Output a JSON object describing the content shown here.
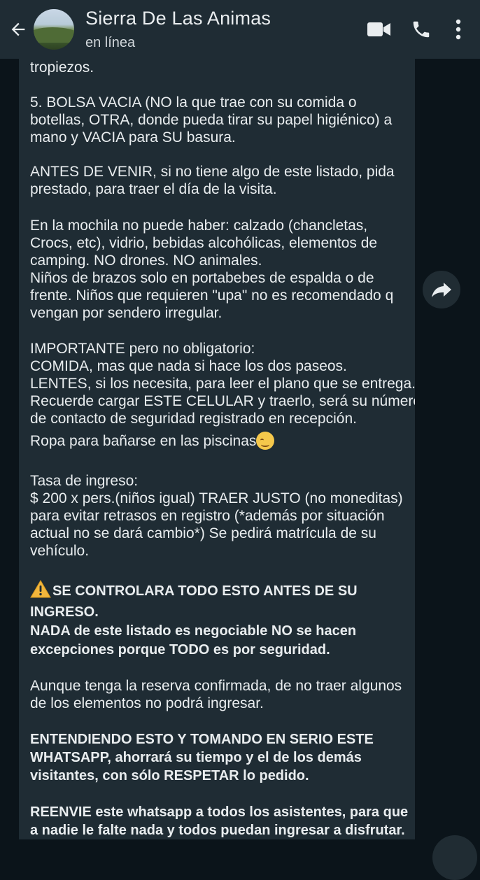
{
  "header": {
    "contact_name": "Sierra De Las Animas",
    "status": "en línea",
    "icons": [
      "back-arrow-icon",
      "video-call-icon",
      "phone-icon",
      "more-options-icon"
    ]
  },
  "message": {
    "lines": [
      "tropiezos.",
      "5. BOLSA VACIA (NO la que trae con su comida o",
      "botellas, OTRA, donde pueda tirar su papel higiénico) a",
      "mano y VACIA para SU basura.",
      "ANTES DE VENIR, si no tiene algo de este listado, pida",
      "prestado, para traer el día de la visita.",
      "En la mochila no puede haber: calzado (chancletas,",
      "Crocs, etc), vidrio, bebidas alcohólicas, elementos de",
      "camping. NO drones. NO animales.",
      "Niños de brazos solo en portabebes de espalda o de",
      "frente. Niños que requieren \"upa\" no es recomendado q",
      "vengan por sendero irregular.",
      "IMPORTANTE pero no obligatorio:",
      "COMIDA, mas que nada si hace los dos paseos.",
      "LENTES, si los necesita, para leer el plano que se entrega.",
      "Recuerde cargar ESTE CELULAR y traerlo, será su número",
      "de contacto de seguridad registrado en recepción.",
      "Ropa para bañarse en las piscinas",
      "Tasa de ingreso:",
      "$ 200 x pers.(niños igual) TRAER JUSTO (no moneditas)",
      "para evitar retrasos en registro (*además por situación",
      "actual no se dará cambio*) Se pedirá matrícula de su",
      "vehículo.",
      "SE CONTROLARA TODO ESTO ANTES DE SU",
      "INGRESO.",
      "NADA de este listado es negociable NO se hacen",
      "excepciones porque TODO es por seguridad.",
      "Aunque tenga la reserva confirmada, de no traer algunos",
      "de los elementos no podrá ingresar.",
      "ENTENDIENDO ESTO Y TOMANDO EN SERIO ESTE",
      "WHATSAPP, ahorrará su tiempo y el de los demás",
      "visitantes, con sólo RESPETAR lo pedido.",
      "REENVIE este whatsapp a todos los asistentes, para que",
      "a nadie le falte nada y todos puedan ingresar a disfrutar."
    ],
    "emoji": "smiling-face-emoji",
    "warning_icon": "warning-icon"
  },
  "colors": {
    "header_bg": "#1f2c34",
    "chat_bg": "#0b141a",
    "bubble_bg": "#1f2c34",
    "text": "#e9edef",
    "icon": "#e9edef"
  }
}
